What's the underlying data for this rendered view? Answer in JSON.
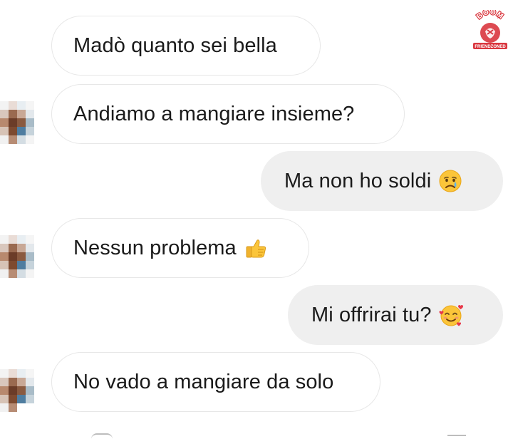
{
  "messages": [
    {
      "id": 1,
      "direction": "incoming",
      "text": "Madò quanto sei bella",
      "avatar": false
    },
    {
      "id": 2,
      "direction": "incoming",
      "text": "Andiamo a mangiare insieme?",
      "avatar": true
    },
    {
      "id": 3,
      "direction": "outgoing",
      "text": "Ma non ho soldi",
      "emoji": "crying-face-icon"
    },
    {
      "id": 4,
      "direction": "incoming",
      "text": "Nessun problema",
      "emoji": "thumbs-up-icon",
      "avatar": true
    },
    {
      "id": 5,
      "direction": "outgoing",
      "text": "Mi offrirai tu?",
      "emoji": "smiling-face-with-hearts-icon"
    },
    {
      "id": 6,
      "direction": "incoming",
      "text": "No vado a mangiare da solo",
      "avatar": true
    }
  ],
  "watermark": {
    "top_text": "BOOM",
    "bottom_text": "FRIENDZONED"
  },
  "colors": {
    "incoming_bubble_bg": "#ffffff",
    "incoming_bubble_border": "#e7e7e7",
    "outgoing_bubble_bg": "#efefef",
    "text": "#1a1a1a",
    "watermark_red": "#d9363e"
  }
}
